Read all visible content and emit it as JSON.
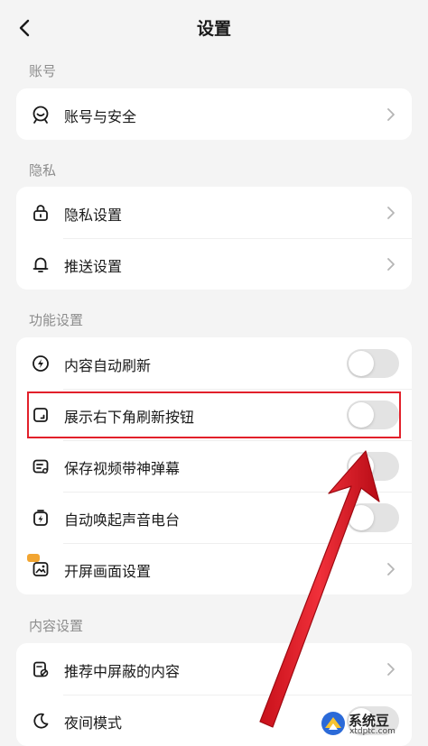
{
  "header": {
    "title": "设置"
  },
  "sections": {
    "account": {
      "label": "账号",
      "items": [
        {
          "label": "账号与安全",
          "icon": "account-icon",
          "control": "chevron"
        }
      ]
    },
    "privacy": {
      "label": "隐私",
      "items": [
        {
          "label": "隐私设置",
          "icon": "lock-icon",
          "control": "chevron"
        },
        {
          "label": "推送设置",
          "icon": "bell-icon",
          "control": "chevron"
        }
      ]
    },
    "function": {
      "label": "功能设置",
      "items": [
        {
          "label": "内容自动刷新",
          "icon": "lightning-icon",
          "control": "toggle",
          "on": false
        },
        {
          "label": "展示右下角刷新按钮",
          "icon": "corner-icon",
          "control": "toggle",
          "on": false
        },
        {
          "label": "保存视频带神弹幕",
          "icon": "danmaku-icon",
          "control": "toggle",
          "on": false
        },
        {
          "label": "自动唤起声音电台",
          "icon": "radio-icon",
          "control": "toggle",
          "on": false
        },
        {
          "label": "开屏画面设置",
          "icon": "splash-image-icon",
          "control": "chevron"
        }
      ]
    },
    "content": {
      "label": "内容设置",
      "items": [
        {
          "label": "推荐中屏蔽的内容",
          "icon": "block-content-icon",
          "control": "chevron"
        },
        {
          "label": "夜间模式",
          "icon": "moon-icon",
          "control": "toggle",
          "on": false
        }
      ]
    }
  },
  "watermark": {
    "name": "系统豆",
    "url": "xtdptc.com"
  },
  "colors": {
    "background": "#f4f4f4",
    "card": "#ffffff",
    "highlight": "#e2202a",
    "toggle_off": "#e3e3e3"
  }
}
